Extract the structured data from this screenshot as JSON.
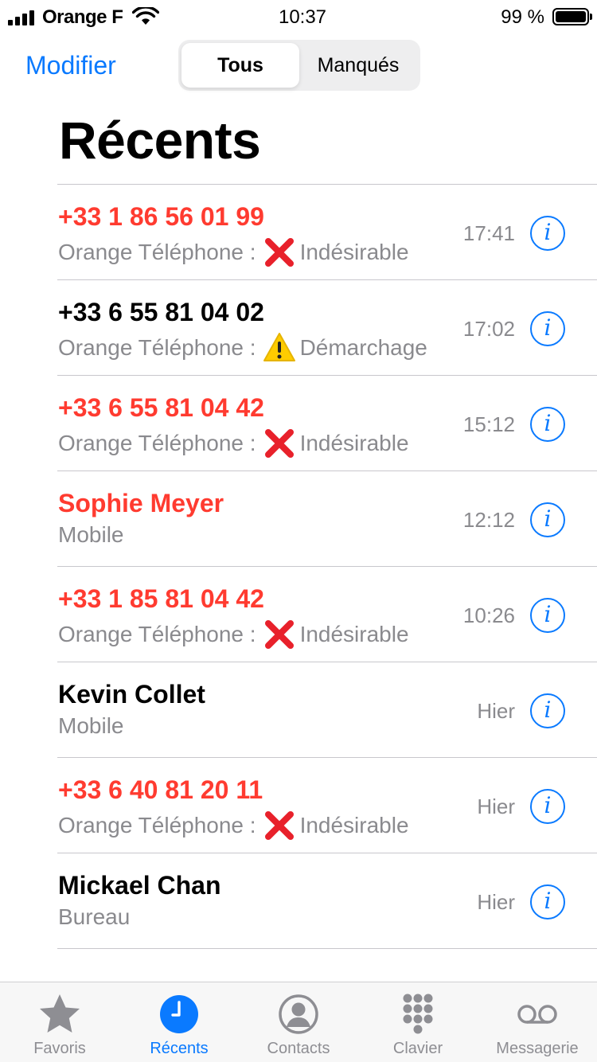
{
  "status_bar": {
    "carrier": "Orange F",
    "time": "10:37",
    "battery": "99 %"
  },
  "nav": {
    "edit_label": "Modifier",
    "segments": [
      "Tous",
      "Manqués"
    ],
    "active_segment": "Tous"
  },
  "page": {
    "title": "Récents"
  },
  "calls": [
    {
      "name": "+33 1 86 56 01 99",
      "missed": true,
      "label": "Orange Téléphone :",
      "badge_icon": "red-cross-icon",
      "badge_text": "Indésirable",
      "time": "17:41"
    },
    {
      "name": "+33 6 55 81 04 02",
      "missed": false,
      "label": "Orange Téléphone :",
      "badge_icon": "warning-icon",
      "badge_text": "Démarchage",
      "time": "17:02"
    },
    {
      "name": "+33 6 55 81 04 42",
      "missed": true,
      "label": "Orange Téléphone :",
      "badge_icon": "red-cross-icon",
      "badge_text": "Indésirable",
      "time": "15:12"
    },
    {
      "name": "Sophie Meyer",
      "missed": true,
      "label": "Mobile",
      "badge_icon": "",
      "badge_text": "",
      "time": "12:12"
    },
    {
      "name": "+33 1 85 81 04 42",
      "missed": true,
      "label": "Orange Téléphone :",
      "badge_icon": "red-cross-icon",
      "badge_text": "Indésirable",
      "time": "10:26"
    },
    {
      "name": "Kevin Collet",
      "missed": false,
      "label": "Mobile",
      "badge_icon": "",
      "badge_text": "",
      "time": "Hier"
    },
    {
      "name": "+33 6 40 81 20 11",
      "missed": true,
      "label": "Orange Téléphone :",
      "badge_icon": "red-cross-icon",
      "badge_text": "Indésirable",
      "time": "Hier"
    },
    {
      "name": "Mickael Chan",
      "missed": false,
      "label": "Bureau",
      "badge_icon": "",
      "badge_text": "",
      "time": "Hier"
    }
  ],
  "tabs": [
    {
      "label": "Favoris",
      "icon": "star-icon",
      "active": false
    },
    {
      "label": "Récents",
      "icon": "clock-icon",
      "active": true
    },
    {
      "label": "Contacts",
      "icon": "person-icon",
      "active": false
    },
    {
      "label": "Clavier",
      "icon": "keypad-icon",
      "active": false
    },
    {
      "label": "Messagerie",
      "icon": "voicemail-icon",
      "active": false
    }
  ],
  "colors": {
    "accent": "#0a7aff",
    "missed": "#ff3b30",
    "secondary_text": "#8a8a8e",
    "inactive_tab": "#8e8e93"
  }
}
